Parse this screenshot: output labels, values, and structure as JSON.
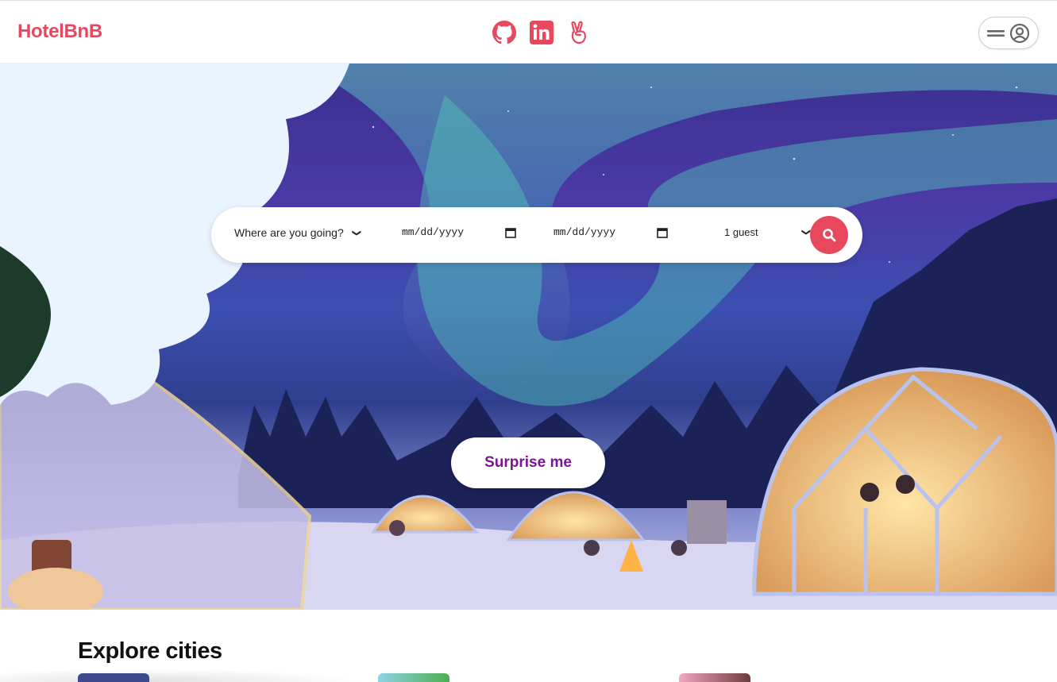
{
  "header": {
    "logo": "HotelBnB",
    "social": [
      {
        "icon": "github-icon"
      },
      {
        "icon": "linkedin-icon"
      },
      {
        "icon": "angellist-icon"
      }
    ],
    "user_menu": {
      "icons": [
        "hamburger-icon",
        "user-circle-icon"
      ]
    }
  },
  "search": {
    "destination": "Where are you going?",
    "checkin": "mm/dd/yyyy",
    "checkout": "mm/dd/yyyy",
    "guests": "1 guest"
  },
  "hero": {
    "surprise_label": "Surprise me"
  },
  "explore": {
    "title": "Explore cities"
  },
  "colors": {
    "brand": "#e8485d",
    "surprise_text": "#7a1394"
  }
}
